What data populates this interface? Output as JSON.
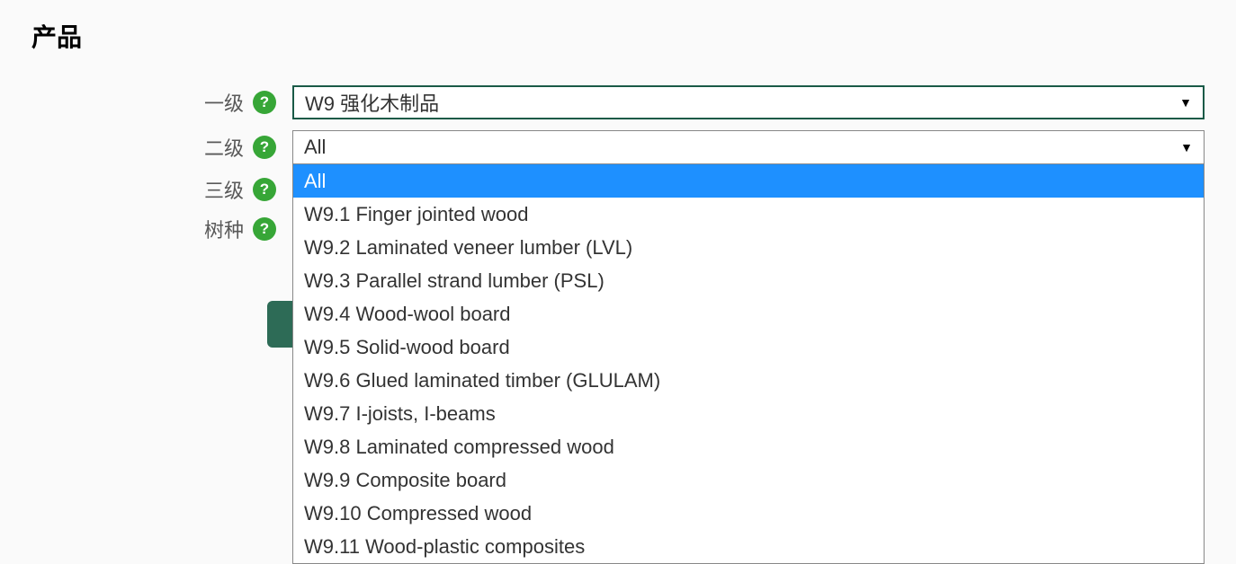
{
  "title": "产品",
  "fields": {
    "level1": {
      "label": "一级",
      "value": "W9 强化木制品"
    },
    "level2": {
      "label": "二级",
      "value": "All",
      "options": [
        "All",
        "W9.1 Finger jointed wood",
        "W9.2 Laminated veneer lumber (LVL)",
        "W9.3 Parallel strand lumber (PSL)",
        "W9.4 Wood-wool board",
        "W9.5 Solid-wood board",
        "W9.6 Glued laminated timber (GLULAM)",
        "W9.7 I-joists, I-beams",
        "W9.8 Laminated compressed wood",
        "W9.9 Composite board",
        "W9.10 Compressed wood",
        "W9.11 Wood-plastic composites"
      ],
      "highlighted_index": 0
    },
    "level3": {
      "label": "三级"
    },
    "species": {
      "label": "树种"
    }
  },
  "help_glyph": "?"
}
